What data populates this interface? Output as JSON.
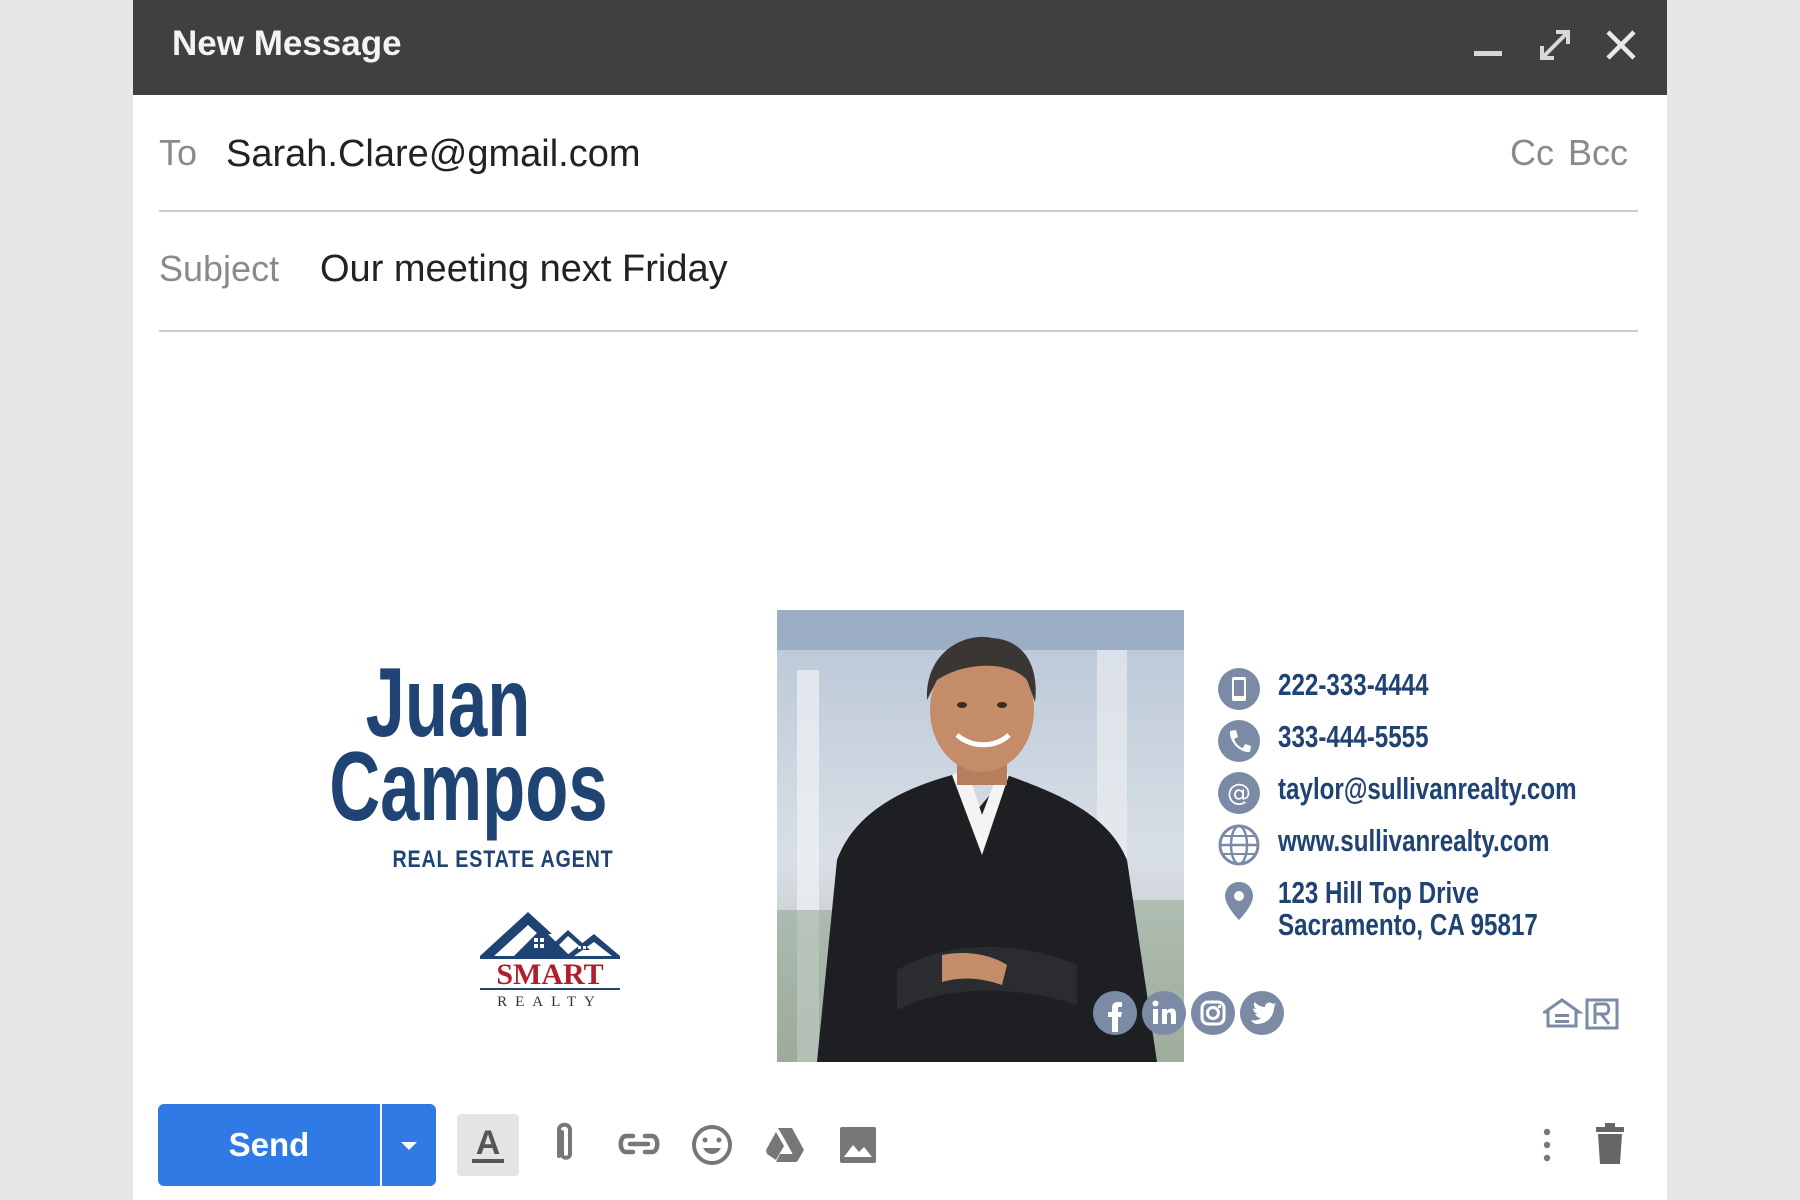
{
  "window": {
    "title": "New Message",
    "controls": [
      "minimize-icon",
      "expand-icon",
      "close-icon"
    ]
  },
  "to": {
    "label": "To",
    "value": "Sarah.Clare@gmail.com",
    "cc": "Cc",
    "bcc": "Bcc"
  },
  "subject": {
    "label": "Subject",
    "value": "Our meeting next Friday"
  },
  "signature": {
    "first_name": "Juan",
    "last_name": "Campos",
    "role": "REAL ESTATE AGENT",
    "logo_text_main": "SMART",
    "logo_text_sub": "REALTY",
    "contacts": [
      {
        "icon": "mobile-phone-icon",
        "text": "222-333-4444"
      },
      {
        "icon": "phone-icon",
        "text": "333-444-5555"
      },
      {
        "icon": "at-icon",
        "text": "taylor@sullivanrealty.com"
      },
      {
        "icon": "globe-icon",
        "text": "www.sullivanrealty.com"
      },
      {
        "icon": "location-pin-icon",
        "text": "123 Hill Top Drive",
        "text2": "Sacramento, CA 95817"
      }
    ],
    "social": [
      "facebook-icon",
      "linkedin-icon",
      "instagram-icon",
      "twitter-icon"
    ],
    "badges": [
      "equal-housing-icon",
      "realtor-icon"
    ]
  },
  "toolbar": {
    "send_label": "Send",
    "tools": [
      "formatting-icon",
      "attach-icon",
      "link-icon",
      "emoji-icon",
      "drive-icon",
      "photo-icon",
      "more-options-icon",
      "trash-icon"
    ]
  },
  "colors": {
    "titlebar": "#404040",
    "accent": "#2f7ae5",
    "signature_blue": "#1f4373",
    "icon_gray": "#7b8ba6"
  }
}
